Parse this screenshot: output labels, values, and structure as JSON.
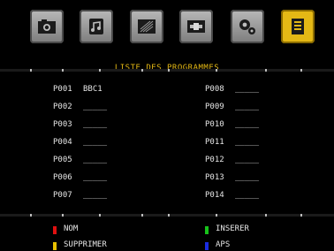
{
  "toolbar": {
    "icons": [
      {
        "name": "picture-icon"
      },
      {
        "name": "music-icon"
      },
      {
        "name": "video-icon"
      },
      {
        "name": "connection-icon"
      },
      {
        "name": "settings-icon"
      },
      {
        "name": "program-list-icon",
        "active": true
      }
    ]
  },
  "header": {
    "title": "LISTE DES PROGRAMMES"
  },
  "programs": {
    "left": [
      {
        "num": "P001",
        "name": "BBC1"
      },
      {
        "num": "P002",
        "name": "_____"
      },
      {
        "num": "P003",
        "name": "_____"
      },
      {
        "num": "P004",
        "name": "_____"
      },
      {
        "num": "P005",
        "name": "_____"
      },
      {
        "num": "P006",
        "name": "_____"
      },
      {
        "num": "P007",
        "name": "_____"
      }
    ],
    "right": [
      {
        "num": "P008",
        "name": "_____"
      },
      {
        "num": "P009",
        "name": "_____"
      },
      {
        "num": "P010",
        "name": "_____"
      },
      {
        "num": "P011",
        "name": "_____"
      },
      {
        "num": "P012",
        "name": "_____"
      },
      {
        "num": "P013",
        "name": "_____"
      },
      {
        "num": "P014",
        "name": "_____"
      }
    ]
  },
  "footer": {
    "keys": [
      {
        "label": "NOM",
        "color": "#e01010"
      },
      {
        "label": "INSERER",
        "color": "#17c21a"
      },
      {
        "label": "SUPPRIMER",
        "color": "#e8c000"
      },
      {
        "label": "APS",
        "color": "#1a2ce0"
      }
    ]
  }
}
